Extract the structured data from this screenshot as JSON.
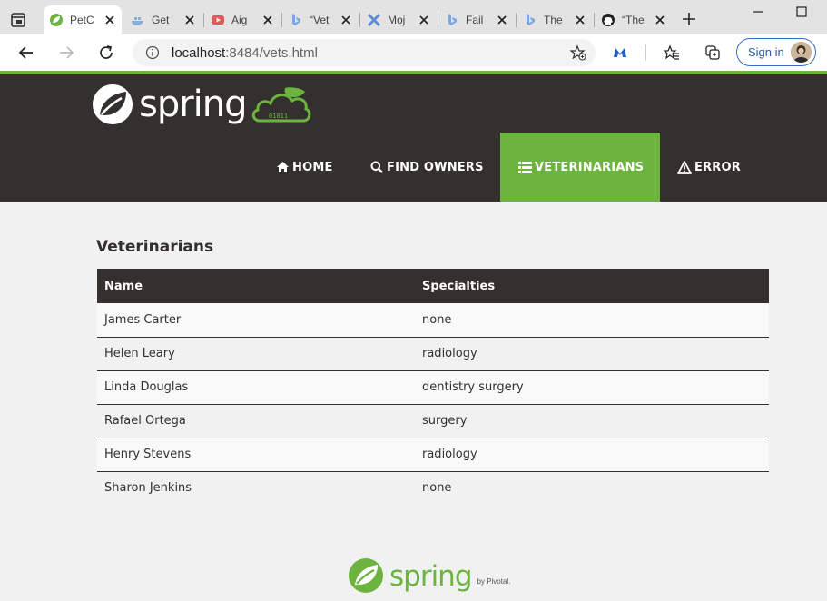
{
  "browser": {
    "tabs": [
      {
        "title": "PetC",
        "favicon": "spring-leaf-icon",
        "active": true
      },
      {
        "title": "Get",
        "favicon": "docker-whale-icon",
        "active": false
      },
      {
        "title": "Aig",
        "favicon": "youtube-icon",
        "active": false
      },
      {
        "title": "“Vet",
        "favicon": "bing-icon",
        "active": false
      },
      {
        "title": "Moj",
        "favicon": "cross-x-icon",
        "active": false
      },
      {
        "title": "Fail",
        "favicon": "bing-icon",
        "active": false
      },
      {
        "title": "The",
        "favicon": "bing-icon",
        "active": false
      },
      {
        "title": "“The",
        "favicon": "github-icon",
        "active": false
      }
    ],
    "url_host": "localhost",
    "url_rest": ":8484/vets.html",
    "signin_label": "Sign in",
    "accent_color": "#6db33f"
  },
  "header": {
    "brand": "spring",
    "nav": [
      {
        "label": "HOME",
        "icon": "home-icon",
        "active": false
      },
      {
        "label": "FIND OWNERS",
        "icon": "search-icon",
        "active": false
      },
      {
        "label": "VETERINARIANS",
        "icon": "list-icon",
        "active": true
      },
      {
        "label": "ERROR",
        "icon": "warning-icon",
        "active": false
      }
    ]
  },
  "main": {
    "title": "Veterinarians",
    "columns": [
      "Name",
      "Specialties"
    ],
    "rows": [
      {
        "name": "James Carter",
        "specialties": "none"
      },
      {
        "name": "Helen Leary",
        "specialties": "radiology"
      },
      {
        "name": "Linda Douglas",
        "specialties": "dentistry surgery"
      },
      {
        "name": "Rafael Ortega",
        "specialties": "surgery"
      },
      {
        "name": "Henry Stevens",
        "specialties": "radiology"
      },
      {
        "name": "Sharon Jenkins",
        "specialties": "none"
      }
    ]
  },
  "footer": {
    "brand": "spring",
    "by_label": "by Pivotal."
  }
}
